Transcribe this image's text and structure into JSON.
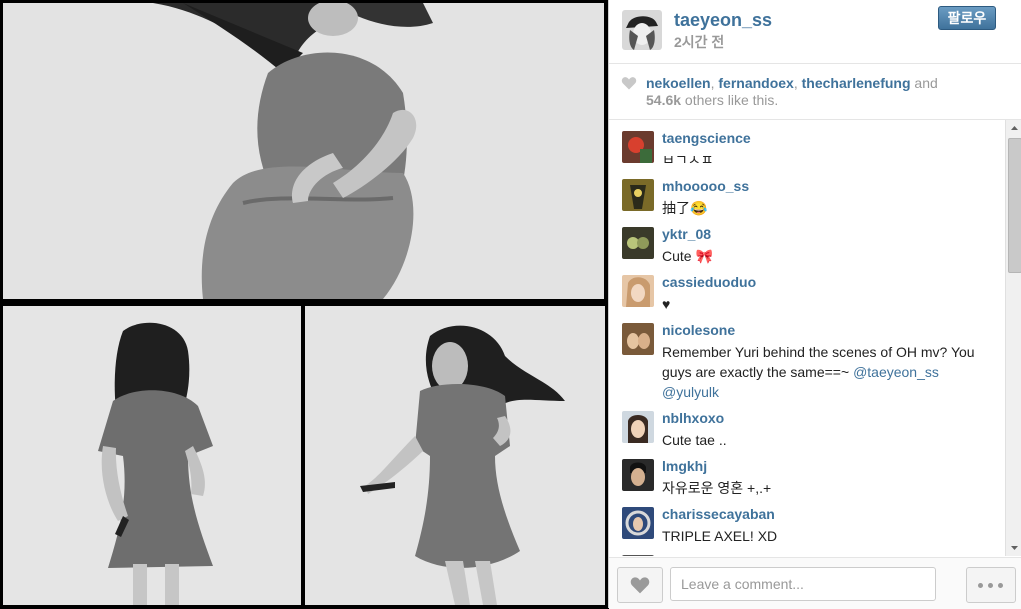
{
  "post": {
    "username": "taeyeon_ss",
    "time_ago": "2시간 전",
    "follow_label": "팔로우"
  },
  "likes": {
    "users": [
      "nekoellen",
      "fernandoex",
      "thecharlenefung"
    ],
    "sep1": ", ",
    "sep2": ", ",
    "and": " and",
    "count": "54.6k",
    "suffix": " others like this."
  },
  "comments": [
    {
      "user": "taengscience",
      "text": "ㅂㄱㅅㅍ"
    },
    {
      "user": "mhooooo_ss",
      "text": "抽了😂"
    },
    {
      "user": "yktr_08",
      "text": "Cute 🎀"
    },
    {
      "user": "cassieduoduo",
      "text": "♥"
    },
    {
      "user": "nicolesone",
      "text": "Remember Yuri behind the scenes of OH mv? You guys are exactly the same==~ ",
      "mention1": "@taeyeon_ss",
      "mention2": "@yulyulk"
    },
    {
      "user": "nblhxoxo",
      "text": "Cute tae .."
    },
    {
      "user": "lmgkhj",
      "text": "자유로운 영혼 +,.+"
    },
    {
      "user": "charissecayaban",
      "text": "TRIPLE AXEL! XD"
    }
  ],
  "composer": {
    "placeholder": "Leave a comment..."
  },
  "icons": {
    "like": "heart-icon",
    "more": "ellipsis-icon"
  },
  "colors": {
    "link": "#3f729b",
    "muted": "#999999",
    "follow_button": "#3f729b"
  }
}
